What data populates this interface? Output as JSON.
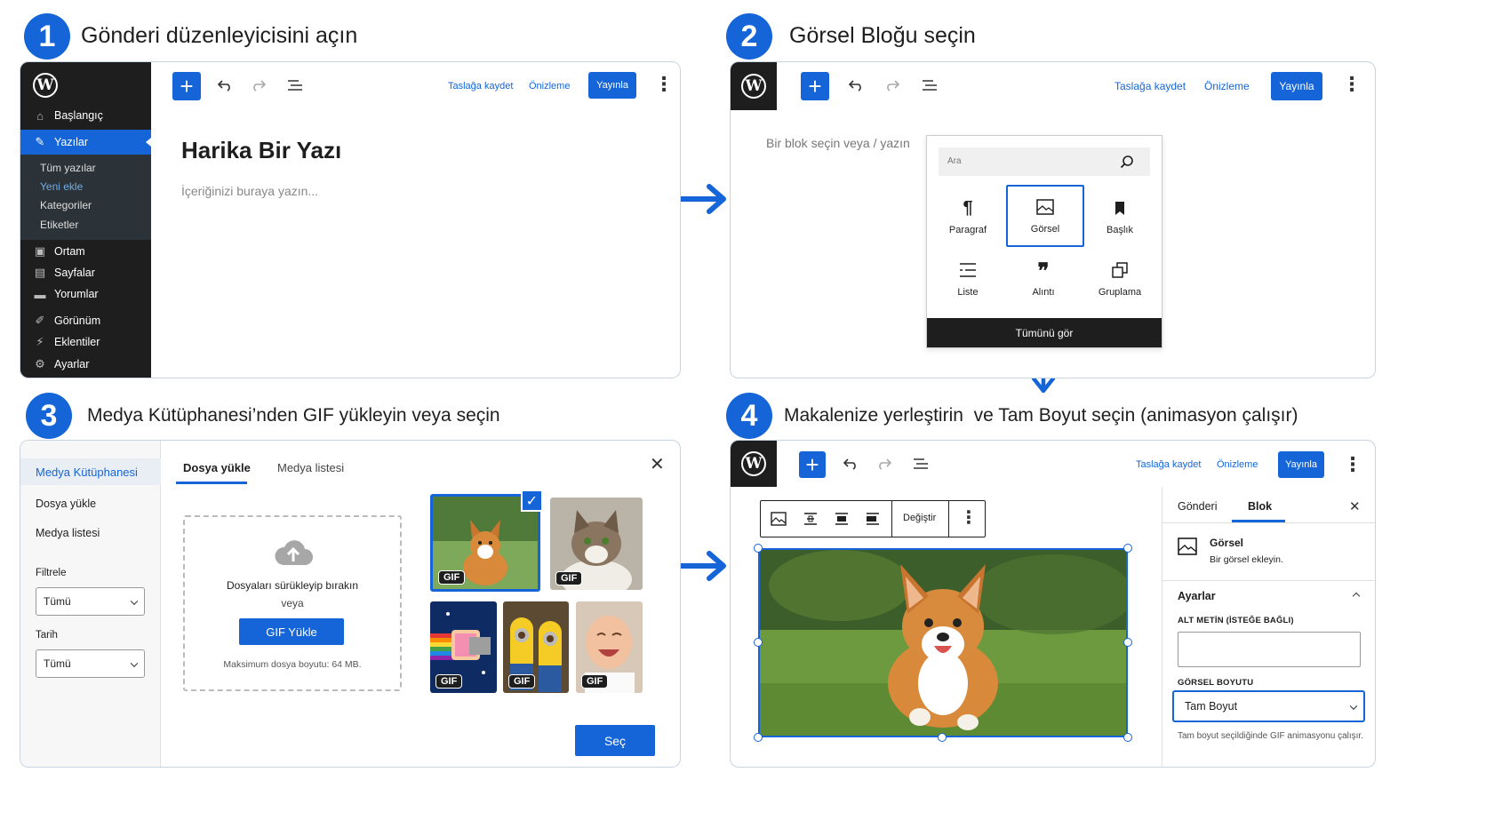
{
  "steps": [
    {
      "num": "1",
      "title": "Gönderi düzenleyicisini açın"
    },
    {
      "num": "2",
      "title": "Görsel Bloğu seçin"
    },
    {
      "num": "3",
      "title": "Medya Kütüphanesi’nden GIF yükleyin veya seçin"
    },
    {
      "num": "4",
      "title": "Makalenize yerleştirin  ve Tam Boyut seçin (animasyon çalışır)"
    }
  ],
  "toolbar": {
    "save_draft": "Taslağa kaydet",
    "preview": "Önizleme",
    "publish": "Yayınla"
  },
  "panel1": {
    "sidebar": {
      "items": [
        {
          "label": "Başlangıç",
          "icon": "home-icon"
        },
        {
          "label": "Yazılar",
          "icon": "pin-icon",
          "active": true
        },
        {
          "label": "Ortam",
          "icon": "media-icon"
        },
        {
          "label": "Sayfalar",
          "icon": "pages-icon"
        },
        {
          "label": "Yorumlar",
          "icon": "comments-icon"
        },
        {
          "label": "Görünüm",
          "icon": "appearance-icon"
        },
        {
          "label": "Eklentiler",
          "icon": "plugins-icon"
        },
        {
          "label": "Ayarlar",
          "icon": "settings-icon"
        }
      ],
      "subitems": [
        "Tüm yazılar",
        "Yeni ekle",
        "Kategoriler",
        "Etiketler"
      ]
    },
    "post_title": "Harika Bir Yazı",
    "content_placeholder": "İçeriğinizi buraya yazın..."
  },
  "panel2": {
    "prompt": "Bir blok seçin veya / yazın",
    "search_placeholder": "Ara",
    "blocks": [
      {
        "label": "Paragraf",
        "icon": "paragraph-icon"
      },
      {
        "label": "Görsel",
        "icon": "image-icon",
        "selected": true
      },
      {
        "label": "Başlık",
        "icon": "bookmark-icon"
      },
      {
        "label": "Liste",
        "icon": "list-icon"
      },
      {
        "label": "Alıntı",
        "icon": "quote-icon"
      },
      {
        "label": "Gruplama",
        "icon": "group-icon"
      }
    ],
    "view_all": "Tümünü gör"
  },
  "panel3": {
    "sidebar_title": "Medya Kütüphanesi",
    "sidebar_links": [
      "Dosya yükle",
      "Medya listesi"
    ],
    "filter_label": "Filtrele",
    "filter_value": "Tümü",
    "date_label": "Tarih",
    "date_value": "Tümü",
    "tabs": [
      "Dosya yükle",
      "Medya listesi"
    ],
    "drop_text": "Dosyaları sürükleyip bırakın",
    "or_text": "veya",
    "upload_button": "GIF Yükle",
    "max_size": "Maksimum dosya boyutu: 64 MB.",
    "gif_badge": "GIF",
    "select_button": "Seç",
    "thumbnails": [
      "corgi",
      "cat",
      "nyan-cat",
      "minions",
      "baby"
    ]
  },
  "panel4": {
    "replace_button": "Değiştir",
    "tabs": [
      "Gönderi",
      "Blok"
    ],
    "block_name": "Görsel",
    "block_desc": "Bir görsel ekleyin.",
    "settings_title": "Ayarlar",
    "alt_label": "ALT METİN (İSTEĞE BAĞLI)",
    "size_label": "GÖRSEL BOYUTU",
    "size_value": "Tam Boyut",
    "size_help": "Tam boyut seçildiğinde GIF animasyonu çalışır."
  },
  "colors": {
    "accent": "#1565d8",
    "dark": "#1e1e1e",
    "border": "#c9d4e2"
  }
}
